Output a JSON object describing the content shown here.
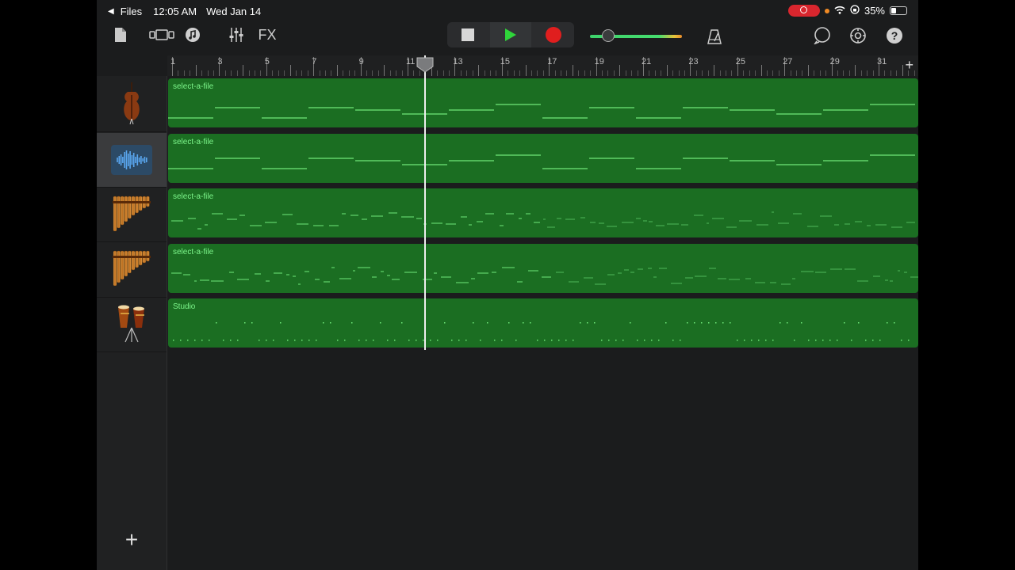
{
  "status_bar": {
    "back_app": "Files",
    "time": "12:05 AM",
    "date": "Wed Jan 14",
    "battery": "35%",
    "battery_level": 0.35
  },
  "toolbar": {
    "fx_label": "FX",
    "volume_level": 0.22
  },
  "ruler": {
    "bar_labels": [
      "1",
      "3",
      "5",
      "7",
      "9",
      "11",
      "13",
      "15",
      "17",
      "19",
      "21",
      "23",
      "25",
      "27",
      "29",
      "31"
    ],
    "playhead_bar": 11.8
  },
  "tracks": [
    {
      "instrument_icon": "cello-icon",
      "region_label": "select-a-file",
      "selected": false
    },
    {
      "instrument_icon": "audio-waveform-icon",
      "region_label": "select-a-file",
      "selected": true
    },
    {
      "instrument_icon": "pan-flute-icon",
      "region_label": "select-a-file",
      "selected": false
    },
    {
      "instrument_icon": "pan-flute-icon",
      "region_label": "select-a-file",
      "selected": false
    },
    {
      "instrument_icon": "drums-icon",
      "region_label": "Studio",
      "selected": false
    }
  ],
  "colors": {
    "region_fill": "#1b6e22",
    "region_label": "#7cf58a",
    "record_red": "#e01e1e",
    "play_green": "#2fd53a"
  }
}
